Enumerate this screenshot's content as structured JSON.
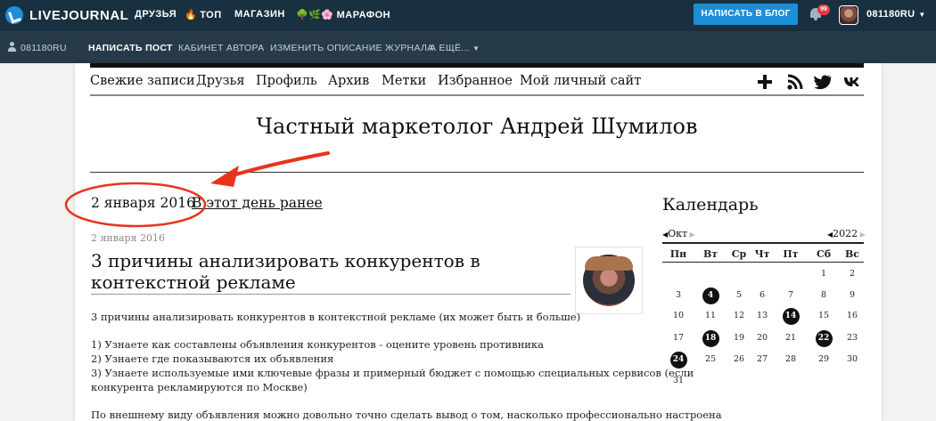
{
  "topbar": {
    "brand": "LIVEJOURNAL",
    "nav": [
      "ДРУЗЬЯ",
      "ТОП",
      "МАГАЗИН",
      "МАРАФОН"
    ],
    "top_emoji": "🔥",
    "marathon_emoji": "🌳🌿🌸",
    "write_button": "НАПИСАТЬ В БЛОГ",
    "notifications_count": "99",
    "username": "081180RU"
  },
  "subbar": {
    "username": "081180RU",
    "items": [
      "НАПИСАТЬ ПОСТ",
      "КАБИНЕТ АВТОРА",
      "ИЗМЕНИТЬ ОПИСАНИЕ ЖУРНАЛА",
      "А ЕЩЁ..."
    ]
  },
  "journal_nav": [
    "Свежие записи",
    "Друзья",
    "Профиль",
    "Архив",
    "Метки",
    "Избранное",
    "Мой личный сайт"
  ],
  "journal_title": "Частный маркетолог Андрей Шумилов",
  "day": {
    "heading": "2 января 2016",
    "earlier_link": "В этот день ранее"
  },
  "post": {
    "date": "2 января 2016",
    "title": "3 причины анализировать конкурентов в контекстной рекламе",
    "lines": [
      "3 причины анализировать конкурентов в контекстной рекламе (их может быть и больше)",
      "1) Узнаете как составлены объявления конкурентов - оцените уровень противника",
      "2) Узнаете где показываются их объявления",
      "3) Узнаете используемые ими ключевые фразы и примерный бюджет с помощью специальных сервисов (если",
      "конкурента рекламируются по Москве)",
      "По внешнему виду объявления можно довольно точно сделать вывод о том, насколько профессионально настроена"
    ]
  },
  "calendar": {
    "title": "Календарь",
    "month": "Окт",
    "year": "2022",
    "weekdays": [
      "Пн",
      "Вт",
      "Ср",
      "Чт",
      "Пт",
      "Сб",
      "Вс"
    ],
    "days": [
      "1",
      "2",
      "3",
      "4",
      "5",
      "6",
      "7",
      "8",
      "9",
      "10",
      "11",
      "12",
      "13",
      "14",
      "15",
      "16",
      "17",
      "18",
      "19",
      "20",
      "21",
      "22",
      "23",
      "24",
      "25",
      "26",
      "27",
      "28",
      "29",
      "30",
      "31"
    ],
    "highlighted": [
      "4",
      "14",
      "18",
      "22",
      "24"
    ]
  },
  "annotation": {
    "color": "#e8341c"
  }
}
